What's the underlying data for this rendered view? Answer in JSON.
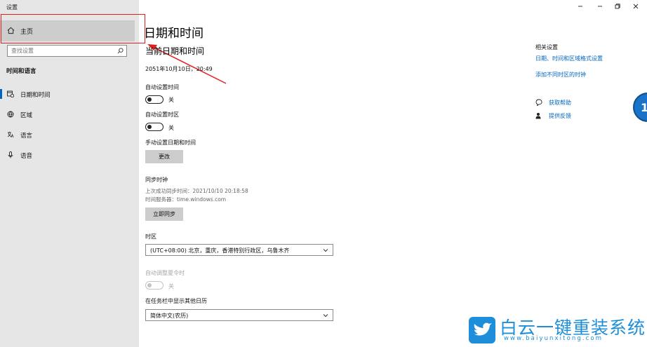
{
  "window": {
    "title": "设置"
  },
  "sidebar": {
    "home_label": "主页",
    "search_placeholder": "查找设置",
    "section_title": "时间和语言",
    "items": [
      {
        "label": "日期和时间",
        "icon": "calendar-clock-icon",
        "active": true
      },
      {
        "label": "区域",
        "icon": "globe-icon",
        "active": false
      },
      {
        "label": "语言",
        "icon": "language-icon",
        "active": false
      },
      {
        "label": "语音",
        "icon": "microphone-icon",
        "active": false
      }
    ]
  },
  "main": {
    "page_title": "日期和时间",
    "current_heading": "当前日期和时间",
    "current_datetime": "2051年10月10日，20:49",
    "auto_time": {
      "label": "自动设置时间",
      "state": "关"
    },
    "auto_timezone": {
      "label": "自动设置时区",
      "state": "关"
    },
    "manual": {
      "label": "手动设置日期和时间",
      "button": "更改"
    },
    "sync": {
      "label": "同步时钟",
      "last_sync": "上次成功同步时间：2021/10/10 20:18:58",
      "server": "时间服务器：time.windows.com",
      "button": "立即同步"
    },
    "timezone": {
      "label": "时区",
      "value": "(UTC+08:00) 北京，重庆，香港特别行政区，乌鲁木齐"
    },
    "dst": {
      "label": "自动调整夏令时",
      "state": "关"
    },
    "calendar": {
      "label": "在任务栏中显示其他日历",
      "value": "简体中文(农历)"
    }
  },
  "related": {
    "title": "相关设置",
    "links": [
      "日期、时间和区域格式设置",
      "添加不同时区的时钟"
    ],
    "help": "获取帮助",
    "feedback": "提供反馈"
  },
  "badge": {
    "text": "1"
  },
  "watermark": {
    "title": "白云一键重装系统",
    "url": "www.baiyunxitong.com"
  },
  "colors": {
    "accent": "#0067c0",
    "highlight": "#e02020",
    "watermark": "#1d8ed9"
  }
}
